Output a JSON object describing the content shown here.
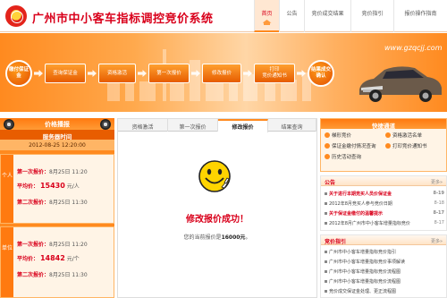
{
  "header": {
    "title": "广州市中小客车指标调控竞价系统",
    "nav": [
      {
        "label": "首页",
        "active": true
      },
      {
        "label": "公告",
        "active": false
      },
      {
        "label": "竞价成交结果",
        "active": false
      },
      {
        "label": "竞价指引",
        "active": false
      },
      {
        "label": "报价操作指南",
        "active": false
      }
    ]
  },
  "banner": {
    "url": "www.gzqcjj.com",
    "steps": [
      "缴付保证金",
      "查询保证金",
      "资格激活",
      "第一次报价",
      "修改报价",
      "打印\n竞价通知书",
      "结果成交确认"
    ]
  },
  "left": {
    "title": "价格播报",
    "subtitle": "服务器时间",
    "time": "2012-08-25  12:20:00",
    "cards": [
      {
        "tag": "个人",
        "first_label": "第一次报价：",
        "first_date": "8月25日  11:20",
        "avg_label": "平均价：",
        "avg_value": "15430",
        "avg_unit": "元/人",
        "second_label": "第二次报价：",
        "second_date": "8月25日  11:30"
      },
      {
        "tag": "单位",
        "first_label": "第一次报价：",
        "first_date": "8月25日  11:20",
        "avg_label": "平均价：",
        "avg_value": "14842",
        "avg_unit": "元/个",
        "second_label": "第二次报价：",
        "second_date": "8月25日  11:30"
      }
    ]
  },
  "center": {
    "tabs": [
      {
        "label": "资格激活",
        "active": false
      },
      {
        "label": "第一次报价",
        "active": false
      },
      {
        "label": "修改报价",
        "active": true
      },
      {
        "label": "结果查询",
        "active": false
      }
    ],
    "success": "修改报价成功！",
    "price_prefix": "您的当前报价是",
    "price_value": "16000元",
    "price_suffix": "。"
  },
  "right": {
    "quick_title": "快捷通道",
    "quick_links": [
      "梯形竞价",
      "资格激活名单",
      "保证金缴付情况查询",
      "打印竞价通知书",
      "历史活动查询"
    ],
    "notice": {
      "title": "公告",
      "more": "更多»",
      "items": [
        {
          "text": "关于进行本期竞买人员价保证金",
          "date": "8-19",
          "hot": true
        },
        {
          "text": "2012年8月竞买人参与竞价日期",
          "date": "8-18",
          "hot": false
        },
        {
          "text": "关于保证金缴付的温馨提示",
          "date": "8-17",
          "hot": true
        },
        {
          "text": "2012年8月广州市中小客车增量指标竞价",
          "date": "8-17",
          "hot": false
        }
      ]
    },
    "guide": {
      "title": "竞价指引",
      "more": "更多»",
      "items": [
        {
          "text": "广州市中小客车增量指标竞价指引"
        },
        {
          "text": "广州市中小客车增量指标竞价事项解读"
        },
        {
          "text": "广州市中小客车增量指标竞价流程图"
        },
        {
          "text": "广州市中小客车增量指标竞价流程图"
        },
        {
          "text": "竞价成交保证金处理、更正流程图"
        }
      ]
    }
  },
  "colors": {
    "brand": "#d9001b",
    "accent": "#ff8a1f"
  }
}
